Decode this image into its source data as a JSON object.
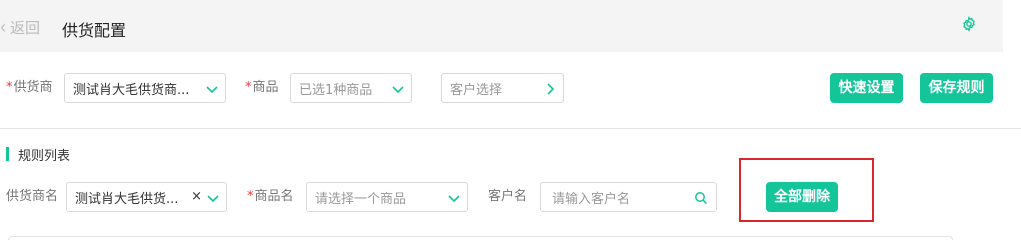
{
  "header": {
    "back_label": "返回",
    "title": "供货配置",
    "back_icon": "chevron-left-icon",
    "settings_icon": "gear-icon"
  },
  "config": {
    "supplier": {
      "label": "供货商",
      "value": "测试肖大毛供货商..."
    },
    "product": {
      "label": "商品",
      "value": "已选1种商品"
    },
    "customer": {
      "placeholder": "客户选择"
    },
    "quick_setup_label": "快速设置",
    "save_rule_label": "保存规则"
  },
  "rules": {
    "section_title": "规则列表",
    "supplier_filter": {
      "label": "供货商名",
      "value": "测试肖大毛供货..."
    },
    "product_filter": {
      "label": "商品名",
      "placeholder": "请选择一个商品"
    },
    "customer_filter": {
      "label": "客户名",
      "placeholder": "请输入客户名"
    },
    "delete_all_label": "全部删除"
  },
  "colors": {
    "accent": "#14c59a",
    "required": "#e83a3a",
    "highlight_box": "#d9262c"
  }
}
